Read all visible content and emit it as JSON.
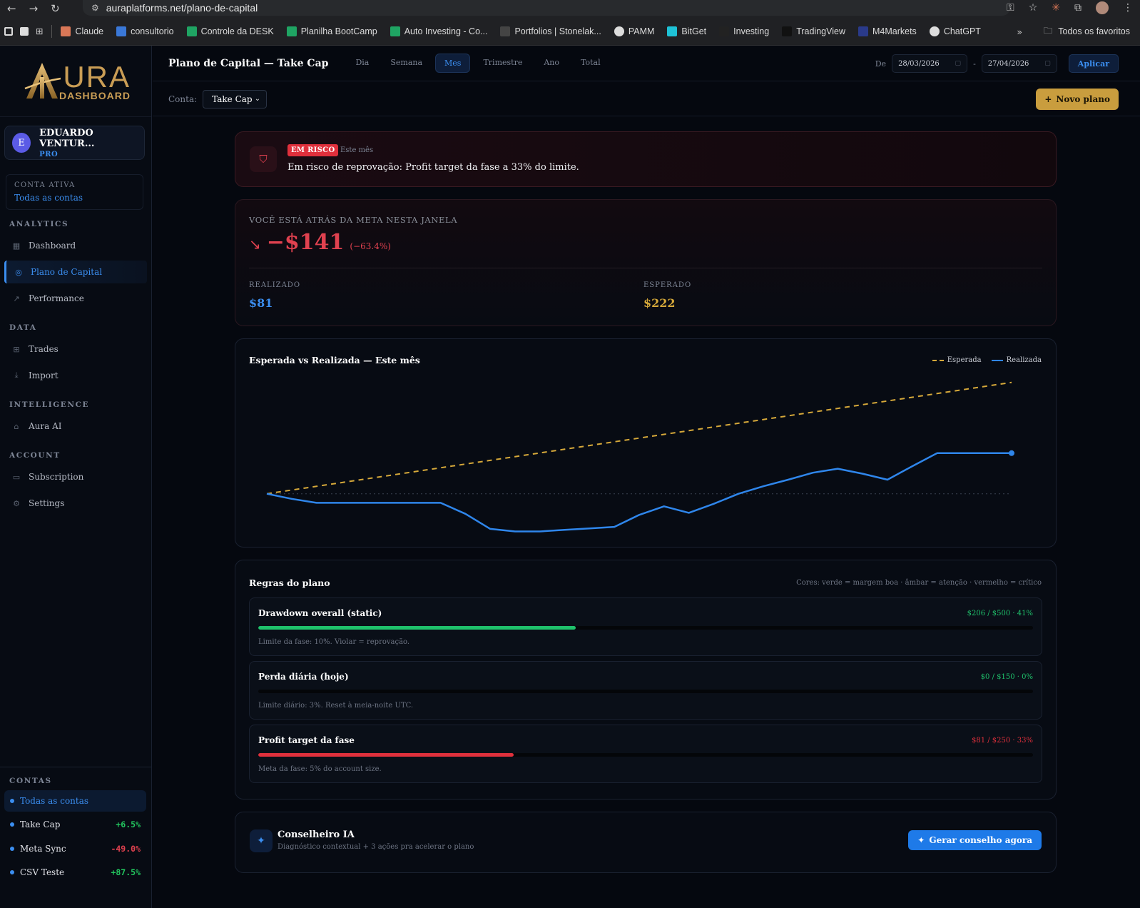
{
  "browser": {
    "url": "auraplatforms.net/plano-de-capital",
    "bookmarks": [
      {
        "label": "Claude",
        "color": "#d97757"
      },
      {
        "label": "consultorio",
        "color": "#3a78d8"
      },
      {
        "label": "Controle da DESK",
        "color": "#1fa463"
      },
      {
        "label": "Planilha BootCamp",
        "color": "#1fa463"
      },
      {
        "label": "Auto Investing - Co...",
        "color": "#1fa463"
      },
      {
        "label": "Portfolios | Stonelak...",
        "color": "#444444"
      },
      {
        "label": "PAMM",
        "color": "#dddddd"
      },
      {
        "label": "BitGet",
        "color": "#1ec2d6"
      },
      {
        "label": "Investing",
        "color": "#222222"
      },
      {
        "label": "TradingView",
        "color": "#111111"
      },
      {
        "label": "M4Markets",
        "color": "#2a3a8a"
      },
      {
        "label": "ChatGPT",
        "color": "#dddddd"
      }
    ],
    "all_bookmarks": "Todos os favoritos"
  },
  "sidebar": {
    "logo_main": "URA",
    "logo_sub": "DASHBOARD",
    "user": {
      "initial": "E",
      "name": "EDUARDO VENTUR...",
      "plan": "PRO"
    },
    "active_account": {
      "title": "CONTA ATIVA",
      "value": "Todas as contas"
    },
    "sections": {
      "analytics": "ANALYTICS",
      "data": "DATA",
      "intelligence": "INTELLIGENCE",
      "account": "ACCOUNT",
      "contas": "CONTAS"
    },
    "nav": {
      "dashboard": "Dashboard",
      "plano": "Plano de Capital",
      "performance": "Performance",
      "trades": "Trades",
      "import": "Import",
      "aura_ai": "Aura AI",
      "subscription": "Subscription",
      "settings": "Settings"
    },
    "contas": [
      {
        "name": "Todas as contas",
        "pct": ""
      },
      {
        "name": "Take Cap",
        "pct": "+6.5%",
        "color": "#22c55e"
      },
      {
        "name": "Meta Sync",
        "pct": "-49.0%",
        "color": "#e0414f"
      },
      {
        "name": "CSV Teste",
        "pct": "+87.5%",
        "color": "#22c55e"
      }
    ]
  },
  "header": {
    "title": "Plano de Capital — Take Cap",
    "tabs": [
      "Dia",
      "Semana",
      "Mes",
      "Trimestre",
      "Ano",
      "Total"
    ],
    "active_tab": "Mes",
    "date_from_label": "De",
    "date_from": "28/03/2026",
    "date_sep": "-",
    "date_to": "27/04/2026",
    "apply": "Aplicar"
  },
  "subbar": {
    "conta_label": "Conta:",
    "conta_value": "Take Cap",
    "new_plan": "Novo plano"
  },
  "alert": {
    "badge": "EM RISCO",
    "period": "Este mês",
    "message": "Em risco de reprovação: Profit target da fase a 33% do limite."
  },
  "gap": {
    "label": "VOCÊ ESTÁ ATRÁS DA META NESTA JANELA",
    "amount": "−$141",
    "pct": "(−63.4%)",
    "realized_label": "REALIZADO",
    "realized_value": "$81",
    "expected_label": "ESPERADO",
    "expected_value": "$222"
  },
  "chart_data": {
    "type": "line",
    "title": "Esperada vs Realizada — Este mês",
    "legend_position": "top-right",
    "x": [
      0,
      1,
      2,
      3,
      4,
      5,
      6,
      7,
      8,
      9,
      10,
      11,
      12,
      13,
      14,
      15,
      16,
      17,
      18,
      19,
      20,
      21,
      22,
      23,
      24,
      25,
      26,
      27,
      28,
      29,
      30
    ],
    "series": [
      {
        "name": "Esperada",
        "color": "#d6a93a",
        "style": "dashed",
        "values": [
          0,
          7.4,
          14.8,
          22.2,
          29.6,
          37,
          44.4,
          51.8,
          59.2,
          66.6,
          74,
          81.4,
          88.8,
          96.2,
          103.6,
          111,
          118.4,
          125.8,
          133.2,
          140.6,
          148,
          155.4,
          162.8,
          170.2,
          177.6,
          185,
          192.4,
          199.8,
          207.2,
          214.6,
          222
        ]
      },
      {
        "name": "Realizada",
        "color": "#2f86eb",
        "style": "solid",
        "values": [
          0,
          -10,
          -18,
          -18,
          -18,
          -18,
          -18,
          -18,
          -40,
          -70,
          -75,
          -75,
          -72,
          -69,
          -66,
          -42,
          -25,
          -38,
          -20,
          0,
          15,
          28,
          42,
          50,
          40,
          28,
          55,
          81,
          81,
          81,
          81
        ]
      }
    ],
    "baseline": 0,
    "ylim": [
      -90,
      240
    ]
  },
  "rules": {
    "title": "Regras do plano",
    "hint": "Cores: verde = margem boa · âmbar = atenção · vermelho = crítico",
    "items": [
      {
        "name": "Drawdown overall (static)",
        "value": "$206 / $500 · 41%",
        "pct": 41,
        "color": "#1fc16b",
        "desc": "Limite da fase: 10%. Violar = reprovação."
      },
      {
        "name": "Perda diária (hoje)",
        "value": "$0 / $150 · 0%",
        "pct": 0,
        "color": "#1fc16b",
        "desc": "Limite diário: 3%. Reset à meia-noite UTC."
      },
      {
        "name": "Profit target da fase",
        "value": "$81 / $250 · 33%",
        "pct": 33,
        "color": "#e0303c",
        "desc": "Meta da fase: 5% do account size."
      }
    ]
  },
  "ai": {
    "title": "Conselheiro IA",
    "subtitle": "Diagnóstico contextual + 3 ações pra acelerar o plano",
    "button": "Gerar conselho agora"
  }
}
